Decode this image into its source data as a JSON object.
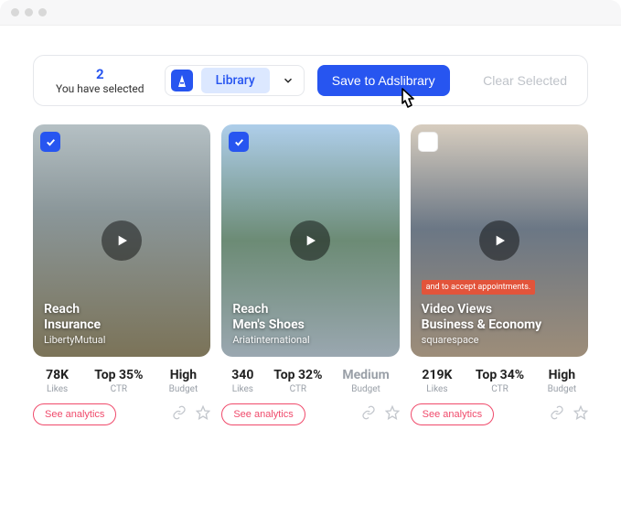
{
  "toolbar": {
    "selected_count": "2",
    "selected_label": "You have selected",
    "dropdown_value": "Library",
    "save_button": "Save to Adslibrary",
    "clear_button": "Clear Selected"
  },
  "cards": [
    {
      "checked": true,
      "metric": "Reach",
      "category": "Insurance",
      "brand": "LibertyMutual",
      "likes_val": "78K",
      "likes_lbl": "Likes",
      "ctr_val": "Top 35%",
      "ctr_lbl": "CTR",
      "budget_val": "High",
      "budget_lbl": "Budget",
      "budget_muted": false,
      "analytics": "See analytics"
    },
    {
      "checked": true,
      "metric": "Reach",
      "category": "Men's Shoes",
      "brand": "Ariatinternational",
      "likes_val": "340",
      "likes_lbl": "Likes",
      "ctr_val": "Top 32%",
      "ctr_lbl": "CTR",
      "budget_val": "Medium",
      "budget_lbl": "Budget",
      "budget_muted": true,
      "analytics": "See analytics"
    },
    {
      "checked": false,
      "metric": "Video Views",
      "category": "Business & Economy",
      "brand": "squarespace",
      "caption": "and to accept appointments.",
      "likes_val": "219K",
      "likes_lbl": "Likes",
      "ctr_val": "Top 34%",
      "ctr_lbl": "CTR",
      "budget_val": "High",
      "budget_lbl": "Budget",
      "budget_muted": false,
      "analytics": "See analytics"
    }
  ]
}
